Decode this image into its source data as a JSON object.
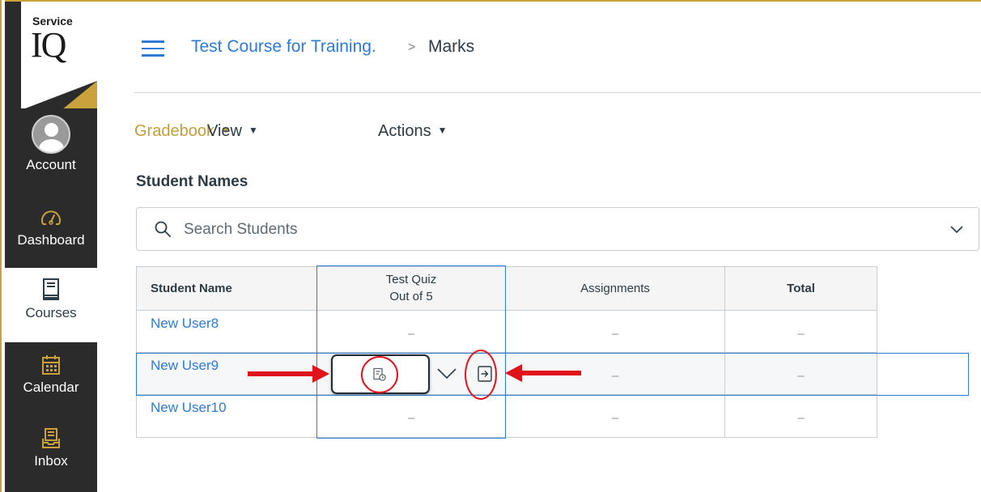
{
  "brand": {
    "line1": "Service",
    "line2": "IQ",
    "gold": "#c9a23c"
  },
  "sidebar": {
    "items": [
      {
        "label": "Account",
        "icon": "user-avatar-icon"
      },
      {
        "label": "Dashboard",
        "icon": "speedometer-icon"
      },
      {
        "label": "Courses",
        "icon": "book-icon"
      },
      {
        "label": "Calendar",
        "icon": "calendar-icon"
      },
      {
        "label": "Inbox",
        "icon": "inbox-icon"
      }
    ]
  },
  "header": {
    "menu_icon": "hamburger-icon",
    "course": "Test Course for Training.",
    "separator": ">",
    "current": "Marks"
  },
  "menubar": {
    "gradebook": "Gradebook",
    "view": "View",
    "actions": "Actions"
  },
  "filter": {
    "label": "Student Names",
    "placeholder": "Search Students"
  },
  "grid": {
    "headers": {
      "student": "Student Name",
      "quiz_name": "Test Quiz",
      "quiz_points": "Out of 5",
      "assignments": "Assignments",
      "total": "Total"
    },
    "rows": [
      {
        "student": "New User8",
        "quiz": "–",
        "assignments": "–",
        "total": "–"
      },
      {
        "student": "New User9",
        "quiz": "",
        "assignments": "–",
        "total": "–"
      },
      {
        "student": "New User10",
        "quiz": "–",
        "assignments": "–",
        "total": "–"
      }
    ]
  },
  "colors": {
    "link": "#2d7bd5",
    "sidebar": "#2b2b2b",
    "accent_gold": "#c59d3a",
    "annotation_red": "#e0121b",
    "selection": "#2d7bd5"
  }
}
